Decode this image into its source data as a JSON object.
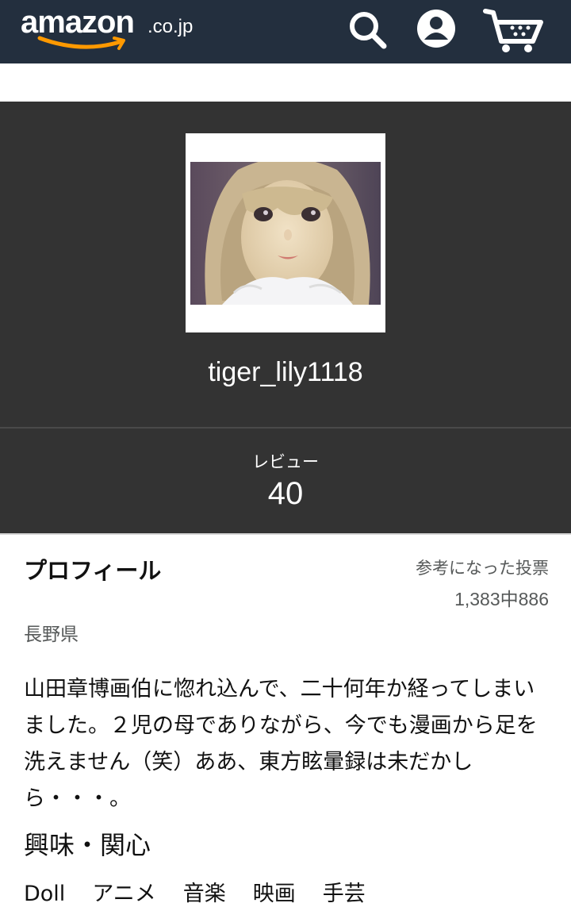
{
  "header": {
    "logo_word": "amazon",
    "logo_tld": ".co.jp",
    "icons": [
      "search-icon",
      "account-icon",
      "cart-icon"
    ],
    "colors": {
      "bar": "#232f3e",
      "smile": "#ff9900"
    }
  },
  "profile": {
    "avatar_icon": "doll-photo",
    "username": "tiger_lily1118",
    "review_label": "レビュー",
    "review_count": "40"
  },
  "section": {
    "title": "プロフィール",
    "votes_label": "参考になった投票",
    "votes_value": "1,383中886",
    "location": "長野県",
    "bio": "山田章博画伯に惚れ込んで、二十何年か経ってしまいました。２児の母でありながら、今でも漫画から足を洗えません（笑）ああ、東方眩暈録は未だかしら・・・。",
    "interests_title": "興味・関心",
    "interests": [
      "Doll",
      "アニメ",
      "音楽",
      "映画",
      "手芸"
    ]
  }
}
